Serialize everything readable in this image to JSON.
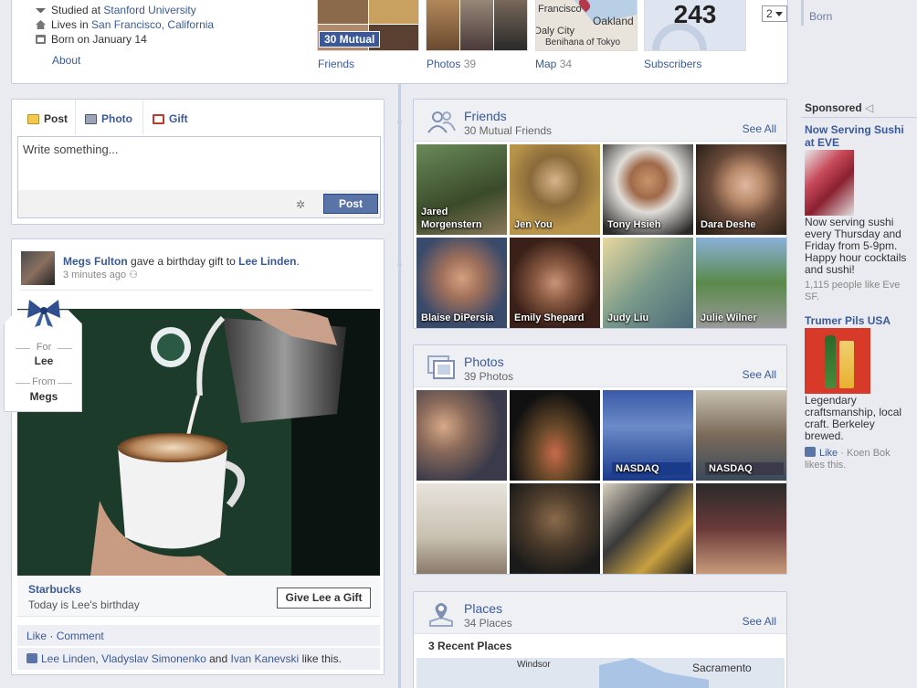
{
  "profile": {
    "studied_prefix": "Studied at",
    "studied_place": "Stanford University",
    "lives_prefix": "Lives in",
    "lives_place": "San Francisco, California",
    "born": "Born on January 14",
    "about": "About",
    "mutual_tag": "30 Mutual",
    "tiles": [
      {
        "label": "Friends",
        "count": ""
      },
      {
        "label": "Photos",
        "count": "39"
      },
      {
        "label": "Map",
        "count": "34"
      },
      {
        "label": "Subscribers",
        "count": ""
      }
    ],
    "map_labels": [
      "Francisco",
      "Oakland",
      "Daly City",
      "Benihana of Tokyo"
    ],
    "subscriber_count": "243",
    "select_value": "2"
  },
  "composer": {
    "tabs": [
      "Post",
      "Photo",
      "Gift"
    ],
    "placeholder": "Write something...",
    "post_button": "Post"
  },
  "story": {
    "actor": "Megs Fulton",
    "verb": "gave a birthday gift to",
    "target": "Lee Linden",
    "time": "3 minutes ago",
    "gift_for_label": "For",
    "gift_for": "Lee",
    "gift_from_label": "From",
    "gift_from": "Megs",
    "merchant": "Starbucks",
    "birthday_text": "Today is Lee's birthday",
    "give_button": "Give Lee a Gift",
    "like": "Like",
    "comment": "Comment",
    "likers": [
      "Lee Linden",
      "Vladyslav Simonenko",
      "Ivan Kanevski"
    ],
    "likes_suffix": "like this."
  },
  "friends": {
    "title": "Friends",
    "subtitle": "30 Mutual Friends",
    "see_all": "See All",
    "people": [
      "Jared Morgenstern",
      "Jen You",
      "Tony Hsieh",
      "Dara Deshe",
      "Blaise DiPersia",
      "Emily Shepard",
      "Judy Liu",
      "Julie Wilner"
    ]
  },
  "photos": {
    "title": "Photos",
    "subtitle": "39 Photos",
    "see_all": "See All",
    "nasdaq_labels": [
      "NASDAQ",
      "NASDAQ"
    ]
  },
  "places": {
    "title": "Places",
    "subtitle": "34 Places",
    "see_all": "See All",
    "recent": "3 Recent Places",
    "map_labels": [
      "Windsor",
      "Sacramento"
    ]
  },
  "sidebar": {
    "born": "Born",
    "sponsored": "Sponsored",
    "ads": [
      {
        "title": "Now Serving Sushi at EVE",
        "body": "Now serving sushi every Thursday and Friday from 5-9pm. Happy hour cocktails and sushi!",
        "meta": "1,115 people like Eve SF."
      },
      {
        "title": "Trumer Pils USA",
        "body": "Legendary craftsmanship, local craft. Berkeley brewed.",
        "like": "Like",
        "liker": "Koen Bok",
        "meta_suffix": "likes this."
      }
    ]
  },
  "colors": {
    "brand": "#3b5998",
    "button": "#5b74a8",
    "background": "#e9ebf1",
    "border": "#c4cde0"
  }
}
